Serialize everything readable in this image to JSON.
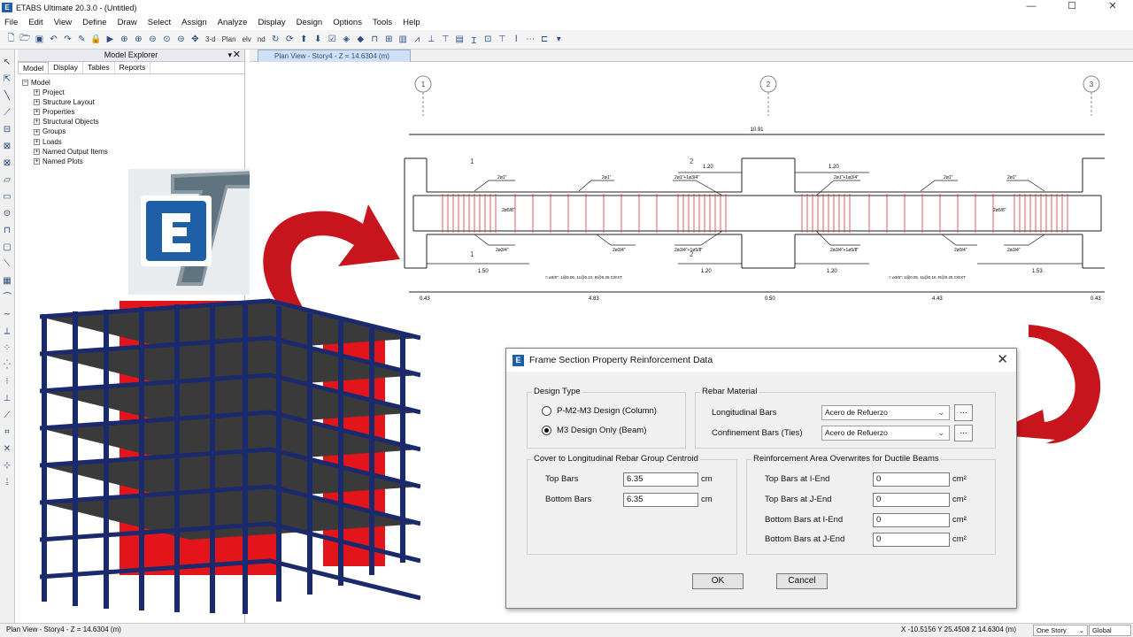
{
  "window": {
    "title": "ETABS Ultimate 20.3.0 - (Untitled)",
    "app_icon_letter": "E",
    "min": "—",
    "max": "☐",
    "close": "✕"
  },
  "menu": [
    "File",
    "Edit",
    "View",
    "Define",
    "Draw",
    "Select",
    "Assign",
    "Analyze",
    "Display",
    "Design",
    "Options",
    "Tools",
    "Help"
  ],
  "toolbar": {
    "view_3d": "3-d",
    "plan_btn": "Plan",
    "elev_btn": "elv",
    "nd_btn": "nd"
  },
  "explorer": {
    "title": "Model Explorer",
    "tabs": [
      "Model",
      "Display",
      "Tables",
      "Reports"
    ],
    "root": "Model",
    "items": [
      "Project",
      "Structure Layout",
      "Properties",
      "Structural Objects",
      "Groups",
      "Loads",
      "Named Output Items",
      "Named Plots"
    ]
  },
  "view_tab": "Plan View - Story4 - Z = 14.6304 (m)",
  "drawing": {
    "grid_labels": [
      "1",
      "2",
      "3"
    ],
    "total_length": "10.91",
    "spans_top": [
      "1.20",
      "1.20"
    ],
    "spans_bottom": [
      "1.50",
      "1.20",
      "1.20",
      "1.53"
    ],
    "bottom_dims": [
      "0.43",
      "4.83",
      "0.50",
      "4.43",
      "0.43"
    ],
    "section_marks": [
      "1",
      "1",
      "2",
      "2"
    ],
    "rebar_notes": [
      "2ø1\"",
      "2ø1\"",
      "2ø1\"+1ø3/4\"",
      "2ø1\"+1ø3/4\"",
      "2ø1\"",
      "2ø1\"",
      "2ø3/4\"",
      "2ø3/4\"",
      "2ø3/4\"+1ø5/8\"",
      "2ø3/4\"+1ø5/8\"",
      "2ø3/4\"",
      "2ø3/4\""
    ],
    "mid_notes": [
      "2ø5/8\"",
      "2ø5/8\""
    ],
    "stirrups": [
      "□ ø3/8\": 1@0.05, 11@0.10, R@0.25 C/EXT",
      "□ ø3/8\": 1@0.05, 11@0.10, R@0.25 C/EXT"
    ]
  },
  "dialog": {
    "icon_letter": "E",
    "title": "Frame Section Property Reinforcement Data",
    "design_type": {
      "title": "Design Type",
      "options": [
        "P-M2-M3 Design  (Column)",
        "M3 Design Only  (Beam)"
      ],
      "selected": "M3 Design Only  (Beam)"
    },
    "rebar_material": {
      "title": "Rebar Material",
      "longitudinal_label": "Longitudinal Bars",
      "longitudinal_value": "Acero de Refuerzo",
      "confinement_label": "Confinement Bars (Ties)",
      "confinement_value": "Acero de Refuerzo",
      "more": "..."
    },
    "cover": {
      "title": "Cover to Longitudinal Rebar Group Centroid",
      "top_label": "Top Bars",
      "top_value": "6.35",
      "bottom_label": "Bottom  Bars",
      "bottom_value": "6.35",
      "unit": "cm"
    },
    "overwrites": {
      "title": "Reinforcement Area Overwrites for Ductile Beams",
      "rows": [
        {
          "label": "Top Bars at I-End",
          "value": "0"
        },
        {
          "label": "Top Bars at J-End",
          "value": "0"
        },
        {
          "label": "Bottom Bars at I-End",
          "value": "0"
        },
        {
          "label": "Bottom Bars at J-End",
          "value": "0"
        }
      ],
      "unit": "cm²"
    },
    "ok": "OK",
    "cancel": "Cancel"
  },
  "status": {
    "left": "Plan View - Story4 - Z = 14.6304 (m)",
    "coords": "X -10.5156  Y 25.4508  Z 14.6304 (m)",
    "story": "One Story",
    "system": "Global"
  },
  "colors": {
    "accent": "#1f5fa8",
    "arrow": "#c8141c",
    "building_frame": "#1a2a6c",
    "building_wall": "#e3151b"
  }
}
